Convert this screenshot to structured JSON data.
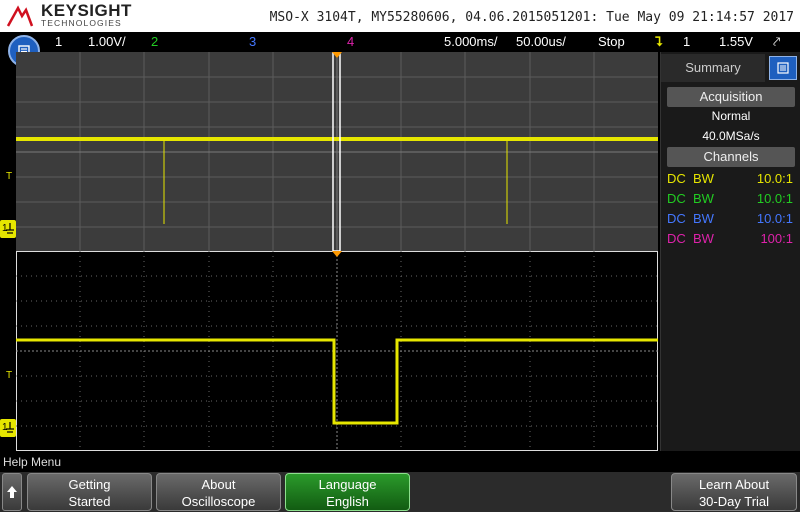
{
  "header": {
    "brand": "KEYSIGHT",
    "brand_sub": "TECHNOLOGIES",
    "instrument_info": "MSO-X 3104T, MY55280606, 04.06.2015051201: Tue May 09 21:14:57 2017"
  },
  "status": {
    "ch1_num": "1",
    "ch1_scale": "1.00V/",
    "ch2_num": "2",
    "ch3_num": "3",
    "ch4_num": "4",
    "timebase": "5.000ms/",
    "zoom_timebase": "50.00us/",
    "run_state": "Stop",
    "trigger_channel": "1",
    "trigger_level": "1.55V"
  },
  "colors": {
    "ch1": "#e6e600",
    "ch2": "#22cc22",
    "ch3": "#4477ff",
    "ch4": "#dd22aa",
    "accent": "#1e5fbf",
    "trigger_marker": "#ff9900"
  },
  "markers": {
    "trigger_zoom": "T",
    "trigger_main": "T"
  },
  "sidebar": {
    "tab_label": "Summary",
    "acquisition_head": "Acquisition",
    "acq_mode": "Normal",
    "sample_rate": "40.0MSa/s",
    "channels_head": "Channels",
    "channels": [
      {
        "coupling": "DC",
        "bw": "BW",
        "ratio": "10.0:1"
      },
      {
        "coupling": "DC",
        "bw": "BW",
        "ratio": "10.0:1"
      },
      {
        "coupling": "DC",
        "bw": "BW",
        "ratio": "10.0:1"
      },
      {
        "coupling": "DC",
        "bw": "BW",
        "ratio": "100:1"
      }
    ]
  },
  "help": {
    "label": "Help Menu"
  },
  "softkeys": [
    {
      "line1": "Getting",
      "line2": "Started"
    },
    {
      "line1": "About",
      "line2": "Oscilloscope"
    },
    {
      "line1": "Language",
      "line2": "English"
    },
    {
      "line1": "Learn About",
      "line2": "30-Day Trial"
    }
  ],
  "icons": {
    "menu": "menu-icon",
    "summary": "summary-icon",
    "trigger": "trigger-icon",
    "ground": "ground-icon",
    "scroll_up": "up-arrow-icon"
  }
}
